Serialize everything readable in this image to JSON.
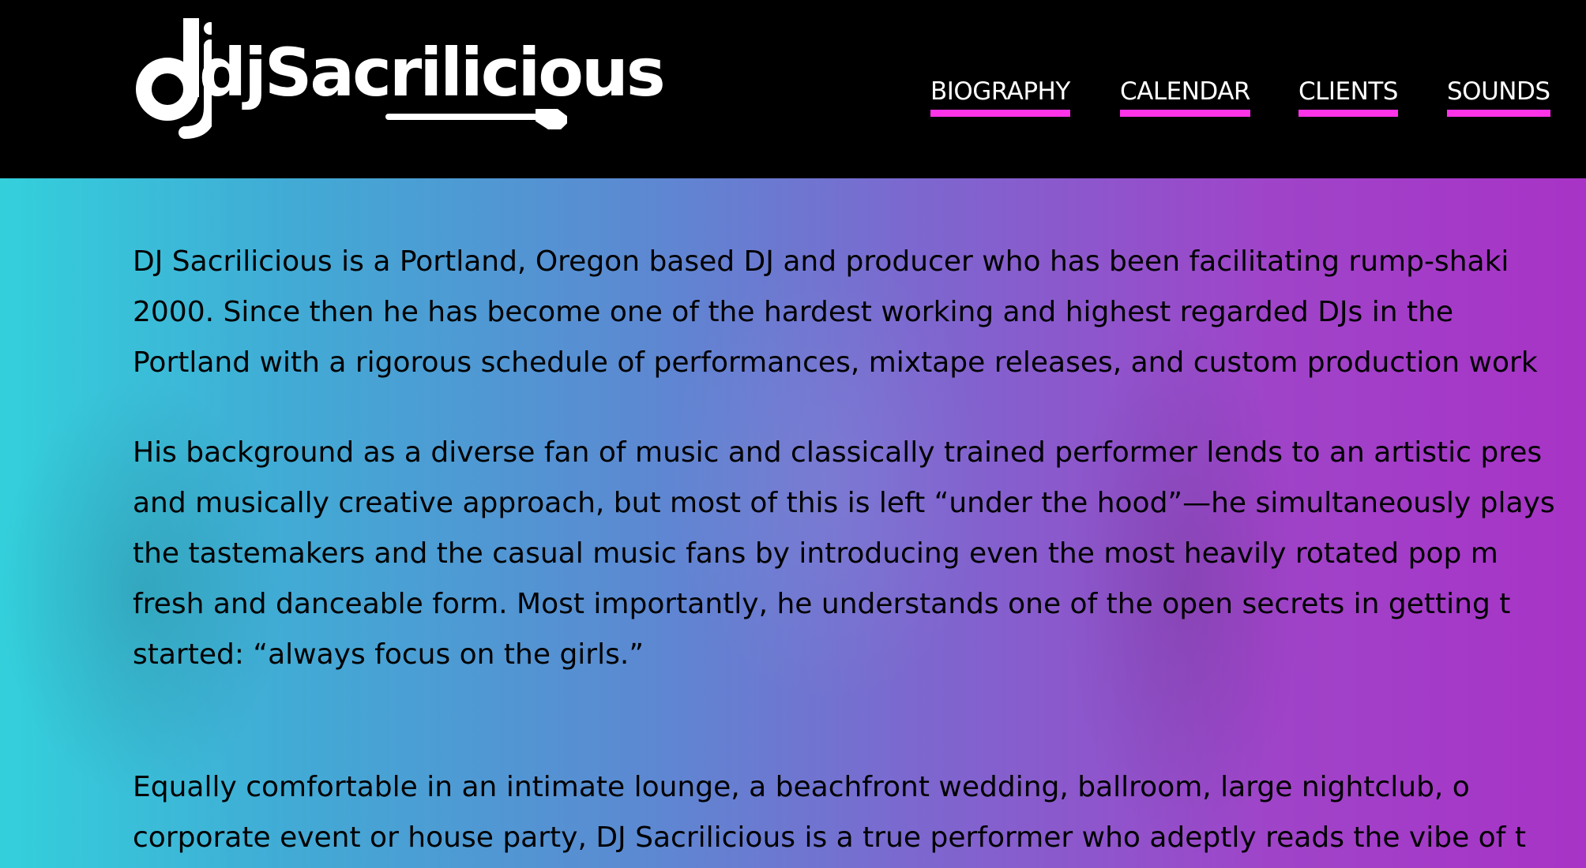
{
  "header": {
    "logo_text": "djSacrilicious",
    "nav": [
      {
        "label": "BIOGRAPHY"
      },
      {
        "label": "CALENDAR"
      },
      {
        "label": "CLIENTS"
      },
      {
        "label": "SOUNDS"
      }
    ]
  },
  "colors": {
    "header_bg": "#000000",
    "nav_underline": "#ff33e8",
    "gradient_left": "#33d0dc",
    "gradient_right": "#a833c6"
  },
  "content": {
    "paragraphs": [
      {
        "lines": [
          "DJ Sacrilicious is a Portland, Oregon based DJ and producer who has been facilitating rump-shaki",
          "2000. Since then he has become one of the hardest working and highest regarded DJs in the",
          "Portland with a rigorous schedule of performances, mixtape releases, and custom production work"
        ]
      },
      {
        "lines": [
          "His background as a diverse fan of music and classically trained performer lends to an artistic pres",
          "and musically creative approach, but most of this is left “under the hood”—he simultaneously plays",
          "the tastemakers and the casual music fans by introducing even the most heavily rotated pop m",
          "fresh and danceable form. Most importantly, he understands one of the open secrets in getting t",
          "started: “always focus on the girls.”"
        ]
      },
      {
        "lines": [
          "Equally comfortable in an intimate lounge, a beachfront wedding, ballroom, large nightclub, o",
          "corporate event or house party, DJ Sacrilicious is a true performer who adeptly reads the vibe of t"
        ]
      }
    ]
  }
}
